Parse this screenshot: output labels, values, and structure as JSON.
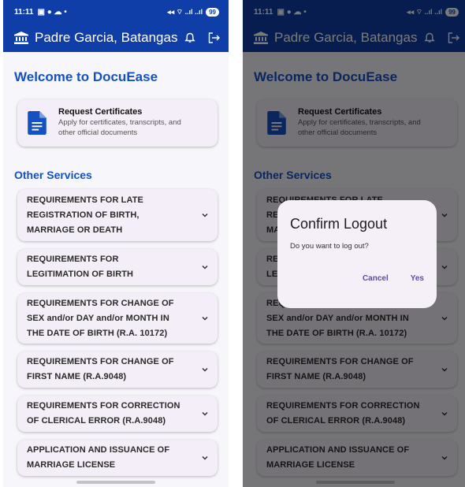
{
  "status_bar": {
    "time": "11:11",
    "left_icons": "▣ ● ☁ •",
    "right_icons": "◂◂ ⌔ ..ıl ..ıl",
    "battery": "99"
  },
  "app_bar": {
    "title": "Padre Garcia, Batangas",
    "bell_icon": "bell-icon",
    "logout_icon": "logout-icon"
  },
  "main": {
    "welcome_title": "Welcome to DocuEase",
    "request_card": {
      "title": "Request Certificates",
      "subtitle_line1": "Apply for certificates, transcripts, and",
      "subtitle_line2": "other official documents"
    },
    "other_services_title": "Other Services",
    "services": [
      {
        "line1": "REQUIREMENTS FOR LATE",
        "line2": "REGISTRATION OF BIRTH,",
        "line3": "MARRIAGE OR DEATH"
      },
      {
        "line1": "REQUIREMENTS FOR",
        "line2": "LEGITIMATION OF BIRTH",
        "line3": ""
      },
      {
        "line1": "REQUIREMENTS FOR CHANGE OF",
        "line2": "SEX and/or DAY and/or MONTH IN",
        "line3": "THE DATE OF BIRTH (R.A. 10172)"
      },
      {
        "line1": "REQUIREMENTS FOR CHANGE OF",
        "line2": "FIRST NAME  (R.A.9048)",
        "line3": ""
      },
      {
        "line1": "REQUIREMENTS FOR CORRECTION",
        "line2": "OF CLERICAL ERROR (R.A.9048)",
        "line3": ""
      },
      {
        "line1": "APPLICATION AND ISSUANCE OF",
        "line2": "MARRIAGE LICENSE",
        "line3": ""
      }
    ]
  },
  "dialog": {
    "title": "Confirm Logout",
    "message": "Do you want to log out?",
    "cancel_label": "Cancel",
    "yes_label": "Yes"
  },
  "colors": {
    "primary": "#0f3ea8",
    "heading": "#1452c4",
    "card": "#f3eef7",
    "dialog_action": "#5b4bb1"
  }
}
